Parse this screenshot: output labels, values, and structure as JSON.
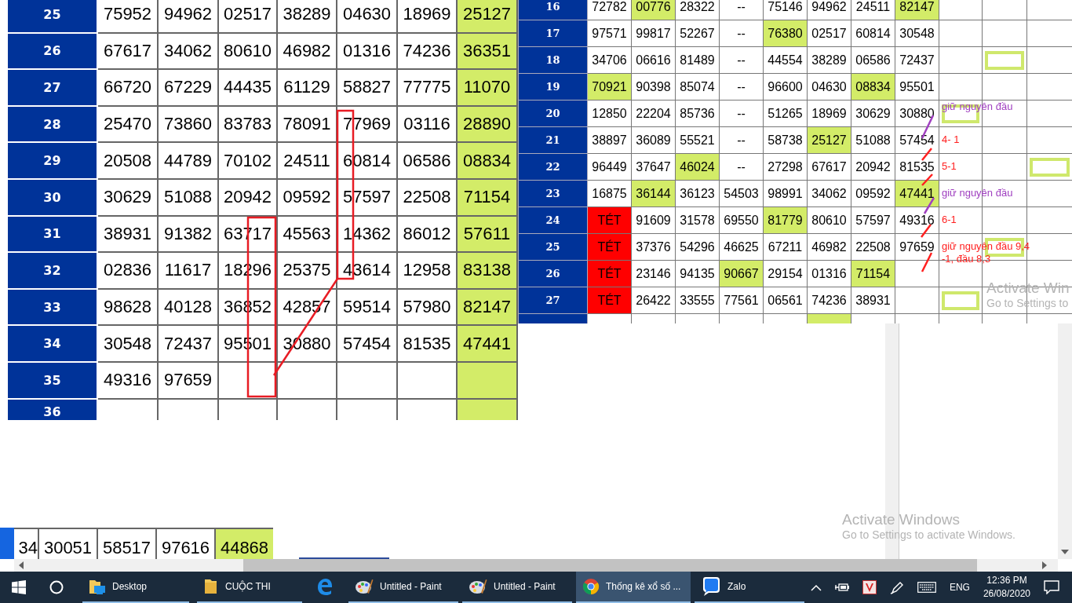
{
  "left_table": {
    "columns": [
      {
        "highlighted": false
      },
      {
        "highlighted": false
      },
      {
        "highlighted": false
      },
      {
        "highlighted": false
      },
      {
        "highlighted": false
      },
      {
        "highlighted": false
      },
      {
        "highlighted": true
      }
    ],
    "rows": [
      {
        "label": "25",
        "cells": [
          "75952",
          "94962",
          "02517",
          "38289",
          "04630",
          "18969",
          "25127"
        ]
      },
      {
        "label": "26",
        "cells": [
          "67617",
          "34062",
          "80610",
          "46982",
          "01316",
          "74236",
          "36351"
        ]
      },
      {
        "label": "27",
        "cells": [
          "66720",
          "67229",
          "44435",
          "61129",
          "58827",
          "77775",
          "11070"
        ]
      },
      {
        "label": "28",
        "cells": [
          "25470",
          "73860",
          "83783",
          "78091",
          "77969",
          "03116",
          "28890"
        ]
      },
      {
        "label": "29",
        "cells": [
          "20508",
          "44789",
          "70102",
          "24511",
          "60814",
          "06586",
          "08834"
        ]
      },
      {
        "label": "30",
        "cells": [
          "30629",
          "51088",
          "20942",
          "09592",
          "57597",
          "22508",
          "71154"
        ]
      },
      {
        "label": "31",
        "cells": [
          "38931",
          "91382",
          "63717",
          "45563",
          "14362",
          "86012",
          "57611"
        ]
      },
      {
        "label": "32",
        "cells": [
          "02836",
          "11617",
          "18296",
          "25375",
          "43614",
          "12958",
          "83138"
        ]
      },
      {
        "label": "33",
        "cells": [
          "98628",
          "40128",
          "36852",
          "42857",
          "59514",
          "57980",
          "82147"
        ]
      },
      {
        "label": "34",
        "cells": [
          "30548",
          "72437",
          "95501",
          "30880",
          "57454",
          "81535",
          "47441"
        ]
      },
      {
        "label": "35",
        "cells": [
          "49316",
          "97659"
        ]
      },
      {
        "label": "36"
      }
    ]
  },
  "right_table": {
    "rows": [
      {
        "label": "16",
        "holiday": false,
        "cells": [
          {
            "text": "72782",
            "highlighted": false
          },
          {
            "text": "00776",
            "highlighted": true
          },
          {
            "text": "28322",
            "highlighted": false
          },
          {
            "text": "--",
            "highlighted": false
          },
          {
            "text": "75146",
            "highlighted": false
          },
          {
            "text": "94962",
            "highlighted": false
          },
          {
            "text": "24511",
            "highlighted": false
          },
          {
            "text": "82147",
            "highlighted": true
          }
        ],
        "boxed": [
          false,
          false,
          false
        ]
      },
      {
        "label": "17",
        "holiday": false,
        "cells": [
          {
            "text": "97571",
            "highlighted": false
          },
          {
            "text": "99817",
            "highlighted": false
          },
          {
            "text": "52267",
            "highlighted": false
          },
          {
            "text": "--",
            "highlighted": false
          },
          {
            "text": "76380",
            "highlighted": true
          },
          {
            "text": "02517",
            "highlighted": false
          },
          {
            "text": "60814",
            "highlighted": false
          },
          {
            "text": "30548",
            "highlighted": false
          }
        ],
        "boxed": [
          false,
          false,
          false
        ]
      },
      {
        "label": "18",
        "holiday": false,
        "cells": [
          {
            "text": "34706",
            "highlighted": false
          },
          {
            "text": "06616",
            "highlighted": false
          },
          {
            "text": "81489",
            "highlighted": false
          },
          {
            "text": "--",
            "highlighted": false
          },
          {
            "text": "44554",
            "highlighted": false
          },
          {
            "text": "38289",
            "highlighted": false
          },
          {
            "text": "06586",
            "highlighted": false
          },
          {
            "text": "72437",
            "highlighted": false
          }
        ],
        "boxed": [
          false,
          true,
          false
        ]
      },
      {
        "label": "19",
        "holiday": false,
        "cells": [
          {
            "text": "70921",
            "highlighted": true
          },
          {
            "text": "90398",
            "highlighted": false
          },
          {
            "text": "85074",
            "highlighted": false
          },
          {
            "text": "--",
            "highlighted": false
          },
          {
            "text": "96600",
            "highlighted": false
          },
          {
            "text": "04630",
            "highlighted": false
          },
          {
            "text": "08834",
            "highlighted": true
          },
          {
            "text": "95501",
            "highlighted": false
          }
        ],
        "boxed": [
          false,
          false,
          false
        ]
      },
      {
        "label": "20",
        "holiday": false,
        "cells": [
          {
            "text": "12850",
            "highlighted": false
          },
          {
            "text": "22204",
            "highlighted": false
          },
          {
            "text": "85736",
            "highlighted": false
          },
          {
            "text": "--",
            "highlighted": false
          },
          {
            "text": "51265",
            "highlighted": false
          },
          {
            "text": "18969",
            "highlighted": false
          },
          {
            "text": "30629",
            "highlighted": false
          },
          {
            "text": "30880",
            "highlighted": false
          }
        ],
        "boxed": [
          true,
          false,
          false
        ],
        "note": {
          "text": "giữ nguyên đầu",
          "color": "#a040c0"
        }
      },
      {
        "label": "21",
        "holiday": false,
        "cells": [
          {
            "text": "38897",
            "highlighted": false
          },
          {
            "text": "36089",
            "highlighted": false
          },
          {
            "text": "55521",
            "highlighted": false
          },
          {
            "text": "--",
            "highlighted": false
          },
          {
            "text": "58738",
            "highlighted": false
          },
          {
            "text": "25127",
            "highlighted": true
          },
          {
            "text": "51088",
            "highlighted": false
          },
          {
            "text": "57454",
            "highlighted": false
          }
        ],
        "boxed": [
          false,
          false,
          false
        ],
        "note": {
          "text": "4- 1",
          "color": "#ff2020"
        }
      },
      {
        "label": "22",
        "holiday": false,
        "cells": [
          {
            "text": "96449",
            "highlighted": false
          },
          {
            "text": "37647",
            "highlighted": false
          },
          {
            "text": "46024",
            "highlighted": true
          },
          {
            "text": "--",
            "highlighted": false
          },
          {
            "text": "27298",
            "highlighted": false
          },
          {
            "text": "67617",
            "highlighted": false
          },
          {
            "text": "20942",
            "highlighted": false
          },
          {
            "text": "81535",
            "highlighted": false
          }
        ],
        "boxed": [
          false,
          false,
          true
        ],
        "note": {
          "text": "5-1",
          "color": "#ff2020"
        }
      },
      {
        "label": "23",
        "holiday": false,
        "cells": [
          {
            "text": "16875",
            "highlighted": false
          },
          {
            "text": "36144",
            "highlighted": true
          },
          {
            "text": "36123",
            "highlighted": false
          },
          {
            "text": "54503",
            "highlighted": false
          },
          {
            "text": "98991",
            "highlighted": false
          },
          {
            "text": "34062",
            "highlighted": false
          },
          {
            "text": "09592",
            "highlighted": false
          },
          {
            "text": "47441",
            "highlighted": true
          }
        ],
        "boxed": [
          false,
          false,
          false
        ],
        "note": {
          "text": "giữ nguyên đầu",
          "color": "#a040c0"
        }
      },
      {
        "label": "24",
        "holiday": true,
        "cells": [
          {
            "text": "TÉT",
            "highlighted": false
          },
          {
            "text": "91609",
            "highlighted": false
          },
          {
            "text": "31578",
            "highlighted": false
          },
          {
            "text": "69550",
            "highlighted": false
          },
          {
            "text": "81779",
            "highlighted": true
          },
          {
            "text": "80610",
            "highlighted": false
          },
          {
            "text": "57597",
            "highlighted": false
          },
          {
            "text": "49316",
            "highlighted": false
          }
        ],
        "boxed": [
          false,
          false,
          false
        ],
        "note": {
          "text": "6-1",
          "color": "#ff2020"
        }
      },
      {
        "label": "25",
        "holiday": true,
        "cells": [
          {
            "text": "TÉT",
            "highlighted": false
          },
          {
            "text": "37376",
            "highlighted": false
          },
          {
            "text": "54296",
            "highlighted": false
          },
          {
            "text": "46625",
            "highlighted": false
          },
          {
            "text": "67211",
            "highlighted": false
          },
          {
            "text": "46982",
            "highlighted": false
          },
          {
            "text": "22508",
            "highlighted": false
          },
          {
            "text": "97659",
            "highlighted": false
          }
        ],
        "boxed": [
          false,
          true,
          false
        ],
        "note": {
          "text": "giữ nguyên đầu 9,4 -1, đầu 8,3",
          "color": "#ff2020"
        }
      },
      {
        "label": "26",
        "holiday": true,
        "cells": [
          {
            "text": "TÉT",
            "highlighted": false
          },
          {
            "text": "23146",
            "highlighted": false
          },
          {
            "text": "94135",
            "highlighted": false
          },
          {
            "text": "90667",
            "highlighted": true
          },
          {
            "text": "29154",
            "highlighted": false
          },
          {
            "text": "01316",
            "highlighted": false
          },
          {
            "text": "71154",
            "highlighted": true
          },
          {
            "highlighted": false
          }
        ],
        "boxed": [
          false,
          false,
          false
        ]
      },
      {
        "label": "27",
        "holiday": true,
        "cells": [
          {
            "text": "TÉT",
            "highlighted": false
          },
          {
            "text": "26422",
            "highlighted": false
          },
          {
            "text": "33555",
            "highlighted": false
          },
          {
            "text": "77561",
            "highlighted": false
          },
          {
            "text": "06561",
            "highlighted": false
          },
          {
            "text": "74236",
            "highlighted": false
          },
          {
            "text": "38931",
            "highlighted": false
          },
          {
            "highlighted": false
          }
        ],
        "boxed": [
          true,
          false,
          false
        ]
      },
      {
        "holiday": false,
        "cells": [
          {
            "highlighted": false
          },
          {
            "highlighted": false
          },
          {
            "highlighted": false
          },
          {
            "highlighted": false
          },
          {
            "highlighted": false
          },
          {
            "highlighted": true
          },
          {
            "highlighted": false
          },
          {
            "highlighted": false
          }
        ],
        "boxed": [
          false,
          false,
          false
        ]
      }
    ]
  },
  "bottom_strip": {
    "cells": [
      {
        "text": "34",
        "highlighted": false
      },
      {
        "text": "30051",
        "highlighted": false
      },
      {
        "text": "58517",
        "highlighted": false
      },
      {
        "text": "97616",
        "highlighted": false
      },
      {
        "text": "44868",
        "highlighted": true
      }
    ]
  },
  "activation_notices": [
    {
      "title": "Activate Win",
      "subtitle": "Go to Settings to"
    },
    {
      "title": "Activate Windows",
      "subtitle": "Go to Settings to activate Windows."
    }
  ],
  "taskbar": {
    "apps": [
      {
        "kind": "explorer",
        "label": "Desktop",
        "open": true,
        "selected": false
      },
      {
        "kind": "folder",
        "label": "CUỘC THI",
        "open": true,
        "selected": false
      },
      {
        "kind": "edge",
        "open": false,
        "selected": false
      },
      {
        "kind": "paint",
        "label": "Untitled - Paint",
        "open": true,
        "selected": false
      },
      {
        "kind": "paint",
        "label": "Untitled - Paint",
        "open": true,
        "selected": false
      },
      {
        "kind": "chrome",
        "label": "Thống kê xổ số ...",
        "open": true,
        "selected": true
      },
      {
        "kind": "zalo",
        "label": "Zalo",
        "open": true,
        "selected": false
      }
    ],
    "language": "ENG",
    "time": "12:36 PM",
    "date": "26/08/2020"
  }
}
